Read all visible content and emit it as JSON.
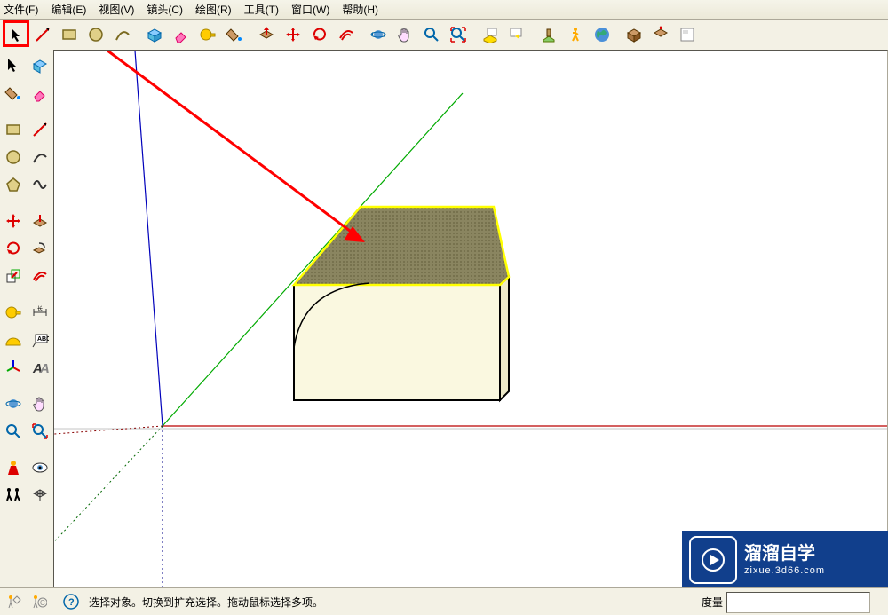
{
  "menu": {
    "file": "文件(F)",
    "edit": "编辑(E)",
    "view": "视图(V)",
    "camera": "镜头(C)",
    "draw": "绘图(R)",
    "tools": "工具(T)",
    "window": "窗口(W)",
    "help": "帮助(H)"
  },
  "status": {
    "hint": "选择对象。切换到扩充选择。拖动鼠标选择多项。",
    "measure_label": "度量"
  },
  "watermark": {
    "title": "溜溜自学",
    "sub": "zixue.3d66.com"
  }
}
